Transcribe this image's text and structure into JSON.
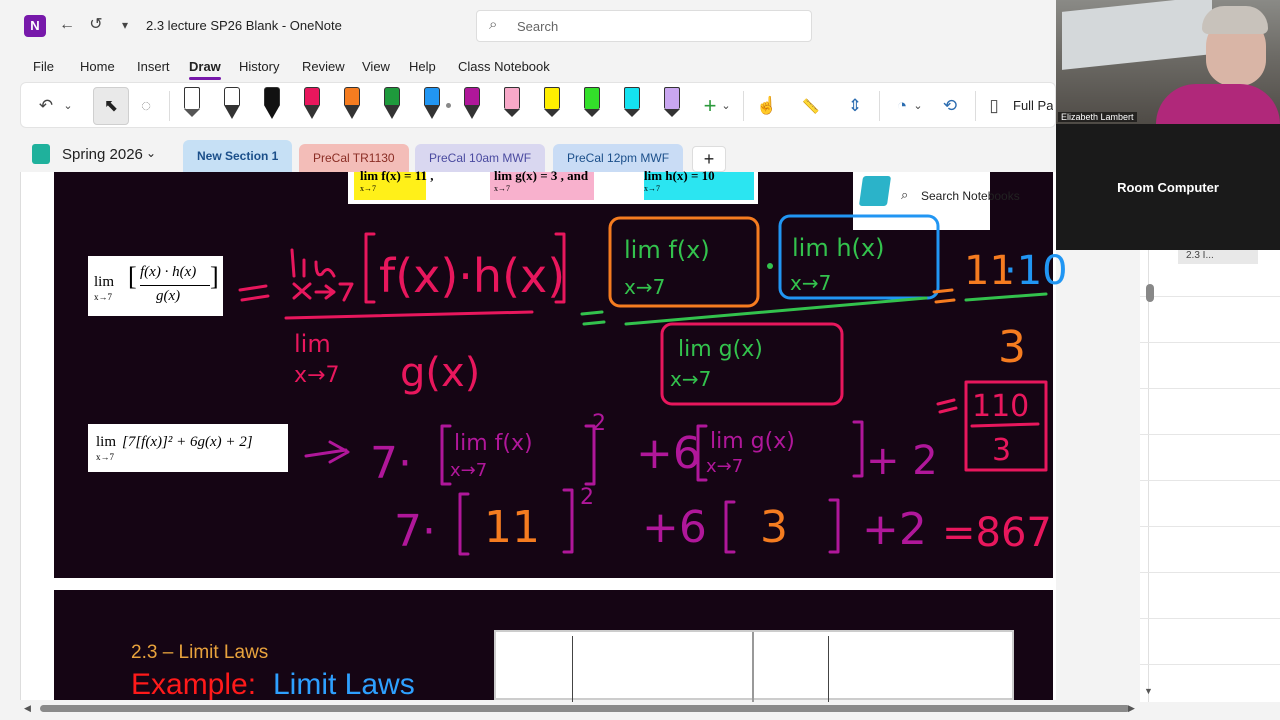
{
  "app": {
    "logo_letter": "N",
    "back_icon": "←",
    "undo_icon": "↺",
    "customize_icon": "▾",
    "title": "2.3 lecture SP26 Blank  -  OneNote"
  },
  "search": {
    "placeholder": "Search",
    "icon": "search-icon"
  },
  "menu": {
    "items": [
      "File",
      "Home",
      "Insert",
      "Draw",
      "History",
      "Review",
      "View",
      "Help",
      "Class Notebook"
    ],
    "active": "Draw"
  },
  "ribbon": {
    "undo_icon": "↶",
    "undo_dropdown": "⌄",
    "select_icon": "⬉",
    "lasso_icon": "◌",
    "pens": [
      {
        "kind": "eraser",
        "color": "#ffffff"
      },
      {
        "kind": "text-pen",
        "color": "#ffffff"
      },
      {
        "kind": "pen",
        "color": "#111111"
      },
      {
        "kind": "pen",
        "color": "#e8175d"
      },
      {
        "kind": "pen",
        "color": "#f57c20"
      },
      {
        "kind": "pen",
        "color": "#1e9a3c"
      },
      {
        "kind": "pen",
        "color": "#2196f3"
      },
      {
        "kind": "pen",
        "color": "#b0179a"
      },
      {
        "kind": "highlighter",
        "color": "#f7a8c8"
      },
      {
        "kind": "highlighter",
        "color": "#ffee00"
      },
      {
        "kind": "highlighter",
        "color": "#33e02a"
      },
      {
        "kind": "highlighter",
        "color": "#14e2f0"
      },
      {
        "kind": "highlighter",
        "color": "#c9a6f0"
      }
    ],
    "add_pen_icon": "+",
    "add_pen_dropdown": "⌄",
    "touch_draw_icon": "☝",
    "ruler_icon": "📏",
    "add_space_icon": "⇕",
    "shapes_icon": "◔",
    "shapes_dropdown": "⌄",
    "ink_to_shape_icon": "⟲",
    "full_page_icon": "▯",
    "full_page_label": "Full Pag"
  },
  "notebook": {
    "name": "Spring 2026",
    "dropdown": "⌄"
  },
  "sections": [
    {
      "label": "New Section 1",
      "bg": "#c6e0f5",
      "active": true
    },
    {
      "label": "PreCal TR1130",
      "bg": "#f3bdb8",
      "active": false
    },
    {
      "label": "PreCal 10am MWF",
      "bg": "#d9d7f0",
      "active": false
    },
    {
      "label": "PreCal 12pm MWF",
      "bg": "#c9dcf5",
      "active": false
    }
  ],
  "add_section": "+",
  "search_notebooks": {
    "icon": "search-icon",
    "label": "Search Notebooks"
  },
  "slide1": {
    "given": {
      "f": "lim f(x) = 11 ,",
      "g": "lim g(x) = 3 , and",
      "h": "lim h(x) = 10",
      "sub": "x→7"
    },
    "formula1": {
      "lim": "lim",
      "sub": "x→7",
      "num": "f(x) · h(x)",
      "den": "g(x)"
    },
    "formula2": {
      "lim": "lim",
      "sub": "x→7",
      "body": "[7[f(x)]² + 6g(x) + 2]"
    }
  },
  "slide2": {
    "subtitle": "2.3 – Limit Laws",
    "example_word": "Example:",
    "title_rest": "Limit Laws"
  },
  "page_pane": {
    "item": "2.3 I..."
  },
  "video": {
    "presenter_name": "Elizabeth Lambert",
    "room_label": "Room Computer"
  },
  "scroll": {
    "left_arrow": "◀",
    "right_arrow": "▶",
    "down_arrow": "▼"
  }
}
